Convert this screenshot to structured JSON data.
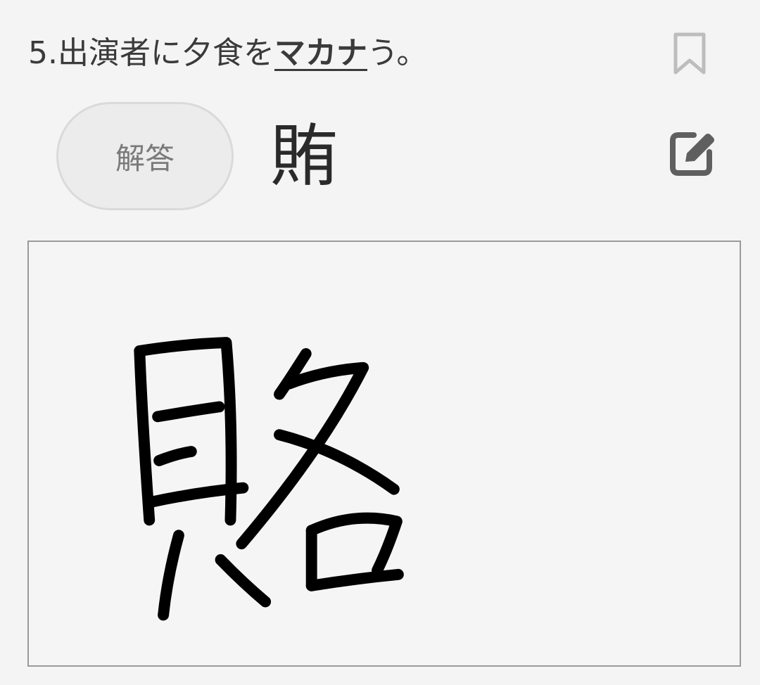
{
  "question": {
    "number": "5.",
    "prefix": "出演者に夕食を",
    "target": "マカナ",
    "suffix": "う。"
  },
  "answer": {
    "button_label": "解答",
    "kanji": "賄"
  },
  "icons": {
    "bookmark": "bookmark-icon",
    "edit": "edit-icon"
  },
  "colors": {
    "background": "#f4f4f4",
    "text": "#3a3a3a",
    "icon": "#5f5f5f",
    "ink": "#000000"
  }
}
